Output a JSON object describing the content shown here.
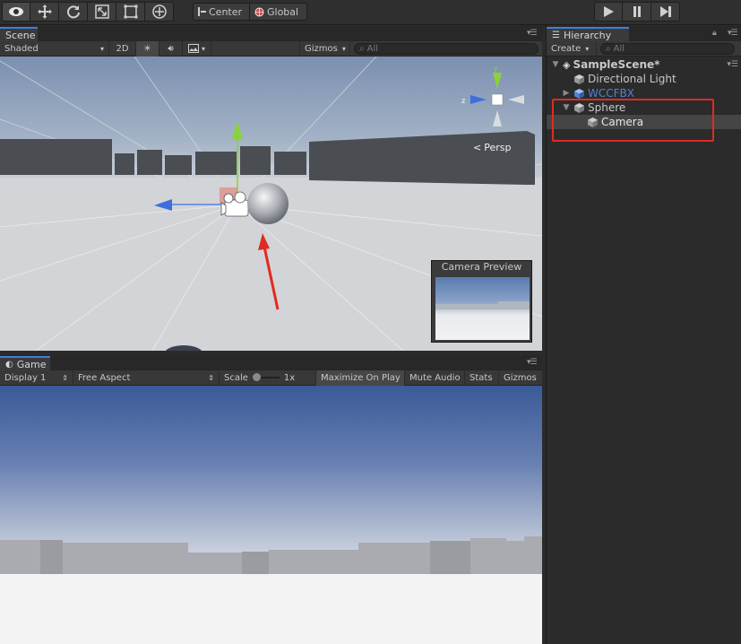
{
  "toolbar": {
    "tools": [
      "hand-tool",
      "move-tool",
      "rotate-tool",
      "scale-tool",
      "rect-tool",
      "transform-tool"
    ],
    "pivot_label": "Center",
    "space_label": "Global",
    "play_controls": [
      "play",
      "pause",
      "step"
    ]
  },
  "scene": {
    "tab_label": "Scene",
    "shading_mode": "Shaded",
    "mode_2d_label": "2D",
    "gizmos_label": "Gizmos",
    "search_placeholder": "All",
    "persp_label": "Persp",
    "axis_y": "y",
    "axis_z": "z",
    "camera_preview_title": "Camera Preview"
  },
  "game": {
    "tab_label": "Game",
    "display_label": "Display 1",
    "aspect_label": "Free Aspect",
    "scale_label": "Scale",
    "scale_value": "1x",
    "maximize_label": "Maximize On Play",
    "mute_label": "Mute Audio",
    "stats_label": "Stats",
    "gizmos_label": "Gizmos"
  },
  "hierarchy": {
    "tab_label": "Hierarchy",
    "create_label": "Create",
    "search_placeholder": "All",
    "scene_name": "SampleScene*",
    "items": [
      {
        "label": "Directional Light",
        "type": "object"
      },
      {
        "label": "WCCFBX",
        "type": "prefab"
      },
      {
        "label": "Sphere",
        "type": "object"
      },
      {
        "label": "Camera",
        "type": "object"
      }
    ]
  },
  "colors": {
    "highlight_box": "#e02b20",
    "annotation_arrow": "#e02b20",
    "tab_accent": "#3d7fd6",
    "prefab_text": "#4f83d6"
  }
}
